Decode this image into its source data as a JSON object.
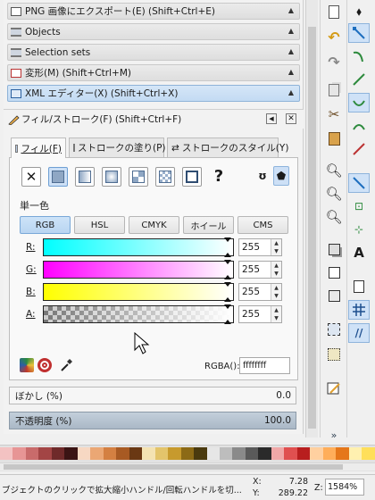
{
  "dock_headers": [
    {
      "label": "PNG 画像にエクスポート(E) (Shift+Ctrl+E)",
      "icon": "export-png-icon"
    },
    {
      "label": "Objects",
      "icon": "objects-icon"
    },
    {
      "label": "Selection sets",
      "icon": "selection-sets-icon"
    },
    {
      "label": "変形(M) (Shift+Ctrl+M)",
      "icon": "transform-icon"
    },
    {
      "label": "XML エディター(X) (Shift+Ctrl+X)",
      "icon": "xml-editor-icon"
    }
  ],
  "fill_stroke": {
    "title": "フィル/ストローク(F) (Shift+Ctrl+F)",
    "tabs": [
      "フィル(F)",
      "ストロークの塗り(P)",
      "ストロークのスタイル(Y)"
    ],
    "paint_type_label": "単一色",
    "paint_help": "?",
    "color_modes": [
      "RGB",
      "HSL",
      "CMYK",
      "ホイール",
      "CMS"
    ],
    "selected_mode": "RGB",
    "channels": [
      {
        "label": "R:",
        "value": "255",
        "color": "#00ffff"
      },
      {
        "label": "G:",
        "value": "255",
        "color": "#ff00ff"
      },
      {
        "label": "B:",
        "value": "255",
        "color": "#ffff00"
      },
      {
        "label": "A:",
        "value": "255",
        "color": "#777777"
      }
    ],
    "rgba_label": "RGBA():",
    "rgba_value": "ffffffff",
    "blur": {
      "label": "ぼかし (%)",
      "value": "0.0"
    },
    "opacity": {
      "label": "不透明度 (%)",
      "value": "100.0"
    }
  },
  "right_toolbar_more": "»",
  "palette": [
    "#f3c2c2",
    "#e79595",
    "#c96b6b",
    "#a34545",
    "#6f2a2a",
    "#3b1414",
    "#f7d8c3",
    "#eba774",
    "#d48042",
    "#a85a23",
    "#6a3813",
    "#f4e3b3",
    "#e3c46b",
    "#c79a2d",
    "#8c6a16",
    "#4a3a0e",
    "#e6e6e6",
    "#bdbdbd",
    "#8a8a8a",
    "#5a5a5a",
    "#2a2a2a",
    "#f0a8a8",
    "#e05050",
    "#b81e1e",
    "#ffd0a0",
    "#ffae5a",
    "#e5771a",
    "#fff0b0",
    "#ffdf5a"
  ],
  "status": {
    "message": "ブジェクトのクリックで拡大縮小ハンドル/回転ハンドルを切...",
    "x_label": "X:",
    "x_value": "7.28",
    "y_label": "Y:",
    "y_value": "289.22",
    "z_label": "Z:",
    "zoom": "1584%"
  }
}
